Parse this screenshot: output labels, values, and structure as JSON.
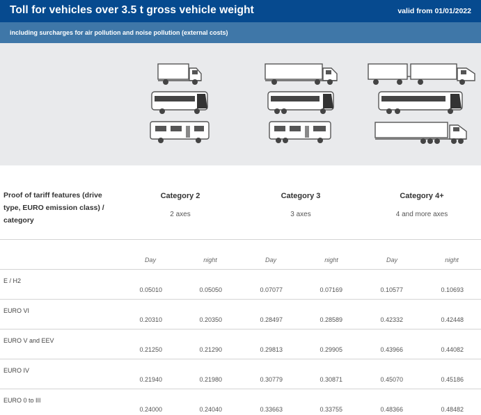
{
  "header": {
    "title": "Toll for vehicles over 3.5 t gross vehicle weight",
    "valid": "valid from 01/01/2022",
    "subtitle": "including surcharges for air pollution and noise pollution (external costs)"
  },
  "vehicles": {
    "cat2": [
      "truck-icon",
      "bus-icon",
      "motorhome-icon"
    ],
    "cat3": [
      "truck-icon",
      "coach-icon",
      "motorhome-icon"
    ],
    "cat4": [
      "truck-trailer-icon",
      "articulated-coach-icon",
      "semi-trailer-icon"
    ]
  },
  "table": {
    "proof_label": "Proof of tariff features (drive type, EURO emission class) / category",
    "categories": [
      {
        "name": "Category 2",
        "axes": "2 axes"
      },
      {
        "name": "Category 3",
        "axes": "3 axes"
      },
      {
        "name": "Category 4+",
        "axes": "4 and more axes"
      }
    ],
    "columns": [
      "Day",
      "night",
      "Day",
      "night",
      "Day",
      "night"
    ],
    "rows": [
      {
        "label": "E / H2",
        "values": [
          "0.05010",
          "0.05050",
          "0.07077",
          "0.07169",
          "0.10577",
          "0.10693"
        ]
      },
      {
        "label": "EURO VI",
        "values": [
          "0.20310",
          "0.20350",
          "0.28497",
          "0.28589",
          "0.42332",
          "0.42448"
        ]
      },
      {
        "label": "EURO V and EEV",
        "values": [
          "0.21250",
          "0.21290",
          "0.29813",
          "0.29905",
          "0.43966",
          "0.44082"
        ]
      },
      {
        "label": "EURO IV",
        "values": [
          "0.21940",
          "0.21980",
          "0.30779",
          "0.30871",
          "0.45070",
          "0.45186"
        ]
      },
      {
        "label": "EURO 0 to III",
        "values": [
          "0.24000",
          "0.24040",
          "0.33663",
          "0.33755",
          "0.48366",
          "0.48482"
        ]
      }
    ]
  }
}
